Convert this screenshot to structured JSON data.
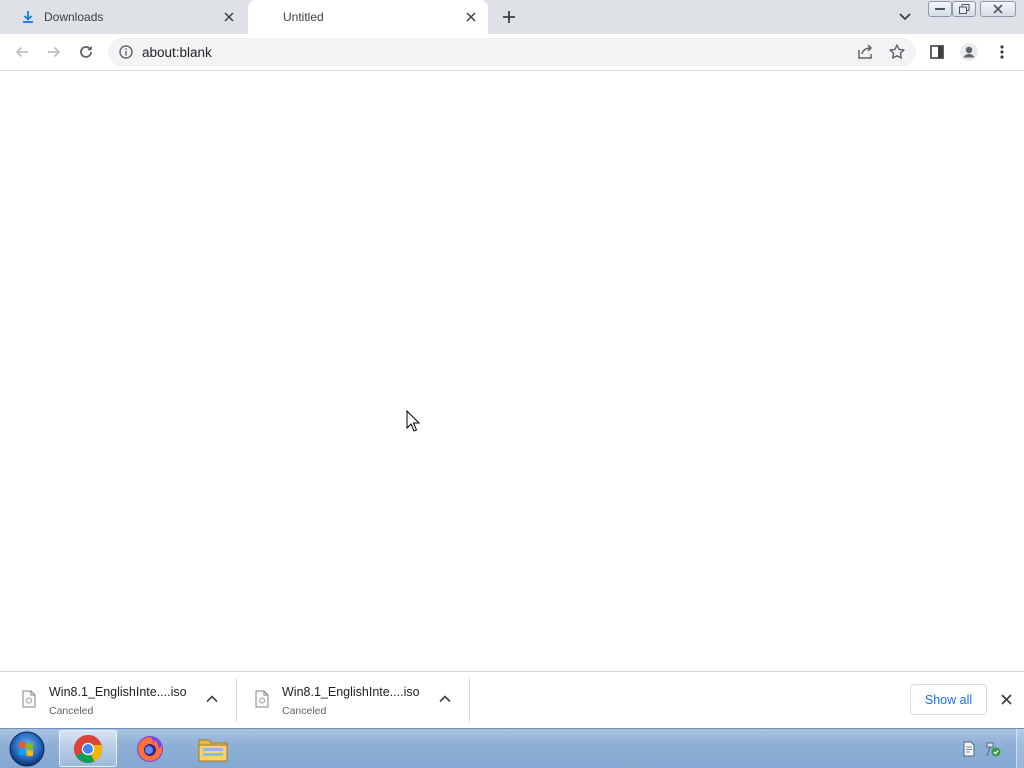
{
  "tabs": [
    {
      "label": "Downloads",
      "icon": "download-icon",
      "active": false
    },
    {
      "label": "Untitled",
      "icon": null,
      "active": true
    }
  ],
  "toolbar": {
    "url": "about:blank",
    "buttons": [
      "back-icon",
      "forward-icon",
      "reload-icon",
      "share-icon",
      "star-icon",
      "side-panel-icon",
      "profile-icon",
      "menu-icon"
    ]
  },
  "downloads": [
    {
      "filename": "Win8.1_EnglishInte....iso",
      "status": "Canceled"
    },
    {
      "filename": "Win8.1_EnglishInte....iso",
      "status": "Canceled"
    }
  ],
  "shelf": {
    "show_all_label": "Show all"
  },
  "taskbar": {
    "apps": [
      "chrome-icon",
      "firefox-icon",
      "file-explorer-icon"
    ],
    "active_app": "chrome-icon"
  },
  "colors": {
    "tabstrip_bg": "#dee1e6",
    "omnibox_bg": "#f1f3f4",
    "accent": "#1a73e8",
    "download_tab_icon": "#1a73e8",
    "taskbar_bg": "#8fb0d6"
  }
}
